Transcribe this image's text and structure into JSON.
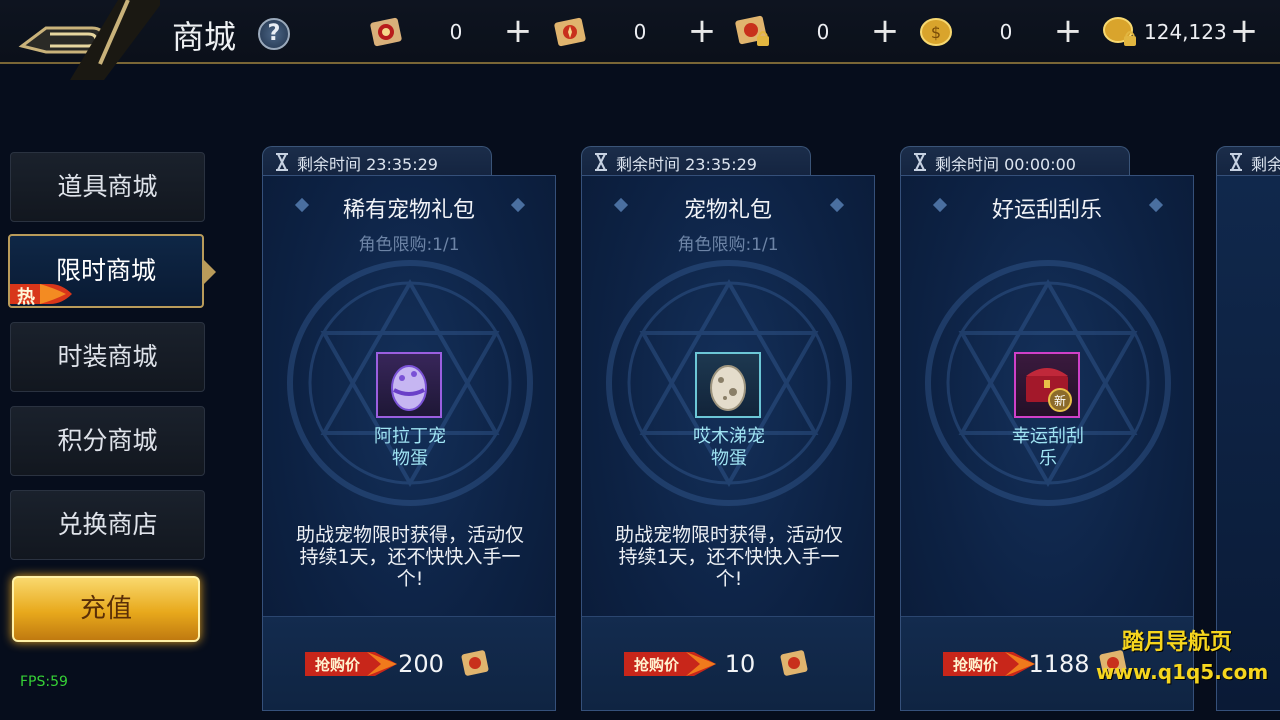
{
  "header": {
    "title": "商城",
    "help_label": "?",
    "resources": [
      {
        "icon": "red-scroll-icon",
        "value": "0"
      },
      {
        "icon": "gold-scroll-icon",
        "value": "0"
      },
      {
        "icon": "locked-scroll-icon",
        "value": "0"
      },
      {
        "icon": "gold-coin-icon",
        "value": "0"
      },
      {
        "icon": "locked-coin-icon",
        "value": "124,123"
      }
    ],
    "plus_label": "+"
  },
  "sidebar": {
    "items": [
      {
        "label": "道具商城"
      },
      {
        "label": "限时商城"
      },
      {
        "label": "时装商城"
      },
      {
        "label": "积分商城"
      },
      {
        "label": "兑换商店"
      }
    ],
    "hot_label": "热",
    "recharge_label": "充值"
  },
  "fps": "FPS:59",
  "cards": [
    {
      "timer_label": "剩余时间 23:35:29",
      "name": "稀有宠物礼包",
      "limit": "角色限购:1/1",
      "item_name_line1": "阿拉丁宠",
      "item_name_line2": "物蛋",
      "description": "助战宠物限时获得，活动仅持续1天，还不快快入手一个!",
      "price_badge": "抢购价",
      "price": "200"
    },
    {
      "timer_label": "剩余时间 23:35:29",
      "name": "宠物礼包",
      "limit": "角色限购:1/1",
      "item_name_line1": "哎木涕宠",
      "item_name_line2": "物蛋",
      "description": "助战宠物限时获得，活动仅持续1天，还不快快入手一个!",
      "price_badge": "抢购价",
      "price": "10"
    },
    {
      "timer_label": "剩余时间 00:00:00",
      "name": "好运刮刮乐",
      "limit": "",
      "item_name_line1": "幸运刮刮",
      "item_name_line2": "乐",
      "new_badge": "新",
      "description": "",
      "price_badge": "抢购价",
      "price": "1188"
    }
  ],
  "card4_timer_label": "剩余",
  "watermark": {
    "line1": "踏月导航页",
    "line2": "www.q1q5.com"
  },
  "colors": {
    "accent_gold": "#b99b5a",
    "recharge": "#e8a91c",
    "fps": "#36d136",
    "watermark": "#f6d61e"
  }
}
